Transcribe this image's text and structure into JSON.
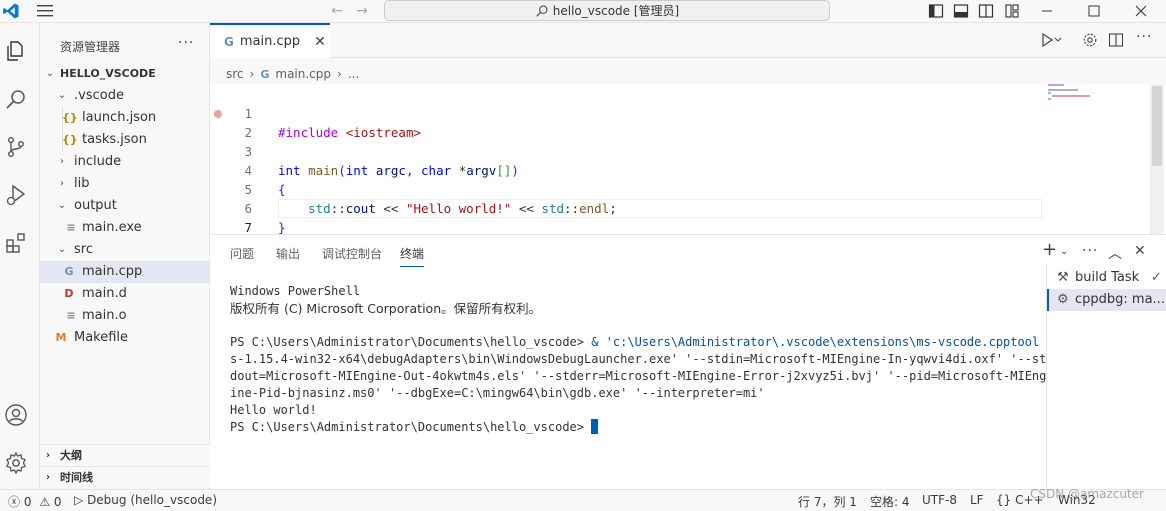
{
  "titlebar": {
    "command_center": "hello_vscode [管理员]"
  },
  "sidebar": {
    "title": "资源管理器",
    "more": "···",
    "root": "HELLO_VSCODE",
    "tree": [
      {
        "label": ".vscode",
        "type": "folder"
      },
      {
        "label": "launch.json",
        "type": "json"
      },
      {
        "label": "tasks.json",
        "type": "json"
      },
      {
        "label": "include",
        "type": "folder"
      },
      {
        "label": "lib",
        "type": "folder"
      },
      {
        "label": "output",
        "type": "folder"
      },
      {
        "label": "main.exe",
        "type": "file"
      },
      {
        "label": "src",
        "type": "folder"
      },
      {
        "label": "main.cpp",
        "type": "cpp"
      },
      {
        "label": "main.d",
        "type": "d"
      },
      {
        "label": "main.o",
        "type": "file"
      },
      {
        "label": "Makefile",
        "type": "make"
      }
    ],
    "outline": "大纲",
    "timeline": "时间线"
  },
  "editor": {
    "tab_label": "main.cpp",
    "breadcrumb": [
      "src",
      "main.cpp",
      "..."
    ],
    "line_numbers": [
      "1",
      "2",
      "3",
      "4",
      "5",
      "6",
      "7"
    ],
    "code": {
      "l1_directive": "#include",
      "l1_header": "<iostream>",
      "l3_int": "int",
      "l3_main": "main",
      "l3_int2": "int",
      "l3_argc": "argc",
      "l3_char": "char",
      "l3_argv": "argv",
      "l4": "{",
      "l5_std": "std",
      "l5_cout": "cout",
      "l5_str": "\"Hello world!\"",
      "l5_endl": "endl",
      "l6": "}"
    }
  },
  "panel": {
    "tabs": [
      "问题",
      "输出",
      "调试控制台",
      "终端"
    ],
    "active_tab": "终端",
    "terminal": {
      "line1": "Windows PowerShell",
      "line2": "版权所有 (C) Microsoft Corporation。保留所有权利。",
      "prompt1": "PS C:\\Users\\Administrator\\Documents\\hello_vscode>",
      "cmd_a": " & 'c:\\Users\\Administrator\\.vscode\\extensions\\ms-vscode.cpptool",
      "cmd_b": "s-1.15.4-win32-x64\\debugAdapters\\bin\\WindowsDebugLauncher.exe' '--stdin=Microsoft-MIEngine-In-yqwvi4di.oxf' '--st",
      "cmd_c": "dout=Microsoft-MIEngine-Out-4okwtm4s.els' '--stderr=Microsoft-MIEngine-Error-j2xvyz5i.bvj' '--pid=Microsoft-MIEng",
      "cmd_d": "ine-Pid-bjnasinz.ms0' '--dbgExe=C:\\mingw64\\bin\\gdb.exe' '--interpreter=mi'",
      "output": "Hello world!",
      "prompt2": "PS C:\\Users\\Administrator\\Documents\\hello_vscode>"
    },
    "terminal_list": [
      "build  Task",
      "cppdbg: ma..."
    ]
  },
  "statusbar": {
    "errors": "0",
    "warnings": "0",
    "debug": "Debug (hello_vscode)",
    "position": "行 7，列 1",
    "spaces": "空格: 4",
    "encoding": "UTF-8",
    "eol": "LF",
    "language": "{} C++",
    "platform": "Win32"
  },
  "watermark": "CSDN @amazcuter",
  "colors": {
    "accent": "#005fb8",
    "keyword": "#0000ff",
    "directive": "#af00db",
    "string": "#a31515",
    "terminal_path": "#0451a5"
  }
}
